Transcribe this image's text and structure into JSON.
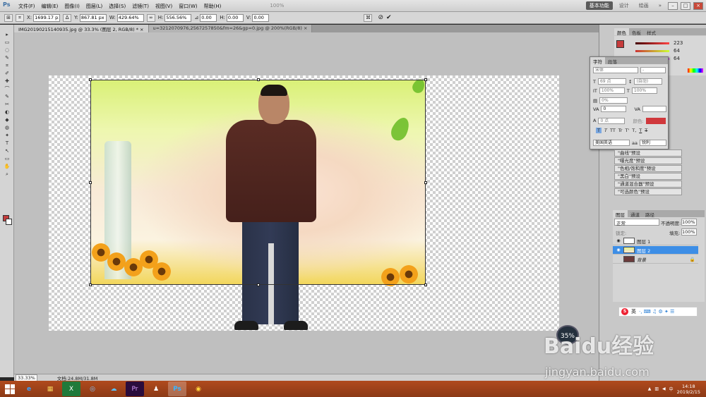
{
  "menubar": {
    "logo": "Ps",
    "items": [
      "文件(F)",
      "编辑(E)",
      "图像(I)",
      "图层(L)",
      "选择(S)",
      "滤镜(T)",
      "视图(V)",
      "窗口(W)",
      "帮助(H)"
    ],
    "zoom_select": "100%",
    "workspace_active": "基本功能",
    "workspace_other1": "设计",
    "workspace_other2": "绘画",
    "workspace_more": "»",
    "min": "–",
    "max": "□",
    "close": "×"
  },
  "options": {
    "x_label": "X:",
    "x_value": "1699.17 px",
    "y_label": "Y:",
    "y_value": "867.81 px",
    "w_label": "W:",
    "w_value": "429.64%",
    "h_label": "H:",
    "h_value": "556.56%",
    "angle_value": "0.00",
    "hskew_label": "H:",
    "hskew_value": "0.00",
    "vskew_label": "V:",
    "vskew_value": "0.00",
    "cancel_icon": "⊘",
    "commit_icon": "✔"
  },
  "tabs": [
    {
      "label": "IMG20190215140935.jpg @ 33.3% (图层 2, RGB/8) * ×",
      "active": true
    },
    {
      "label": "u=3212070976,2567257850&fm=26&gp=0.jpg @ 200%(RGB/8) ×",
      "active": false
    }
  ],
  "tools": [
    "▸",
    "▭",
    "◌",
    "✎",
    "⌗",
    "✐",
    "✚",
    "⌒",
    "✎",
    "✂",
    "◐",
    "◆",
    "◍",
    "✦",
    "T",
    "↖",
    "▭",
    "✋",
    "⌕"
  ],
  "status": {
    "zoom": "33.33%",
    "doc": "文档:24.8M/31.8M"
  },
  "color_panel": {
    "tabs": [
      "颜色",
      "色板",
      "样式"
    ],
    "r": "223",
    "g": "64",
    "b": "64",
    "fg_color": "#c63c3c"
  },
  "char_panel": {
    "tabs": [
      "字符",
      "段落"
    ],
    "font": "宋体",
    "style": "-",
    "size": "69 点",
    "leading": "(自动)",
    "vscale": "100%",
    "hscale": "100%",
    "tracking_pct": "0%",
    "kerning": "0",
    "baseline": "0 点",
    "color_label": "颜色:",
    "style_buttons": [
      "T",
      "T",
      "TT",
      "Tr",
      "T'",
      "T,",
      "T",
      "T"
    ],
    "language": "美国英语",
    "aa": "锐利"
  },
  "presets": [
    "\"曲线\"预设",
    "\"曝光度\"预设",
    "\"色相/饱和度\"预设",
    "\"黑白\"预设",
    "\"通道混合器\"预设",
    "\"可选颜色\"预设"
  ],
  "layers": {
    "tabs": [
      "图层",
      "通道",
      "路径"
    ],
    "blend": "正常",
    "opacity_label": "不透明度:",
    "opacity": "100%",
    "fill_label": "填充:",
    "fill": "100%",
    "lock_label": "锁定:",
    "rows": [
      {
        "name": "图层 1",
        "selected": false
      },
      {
        "name": "图层 2",
        "selected": true
      },
      {
        "name": "背景",
        "selected": false
      }
    ]
  },
  "ime": {
    "logo": "S",
    "lang": "英",
    "icons": "·, ⌨ ♫ ⚙ ✦ ☰"
  },
  "zoom_badge": "35%",
  "watermark": {
    "brand": "Baidu经验",
    "url": "jingyan.baidu.com"
  },
  "taskbar": {
    "apps": [
      "e",
      "▦",
      "X",
      "◎",
      "☁",
      "Pr",
      "♟",
      "Ps",
      "◉"
    ],
    "time": "14:18",
    "date": "2019/2/15"
  }
}
